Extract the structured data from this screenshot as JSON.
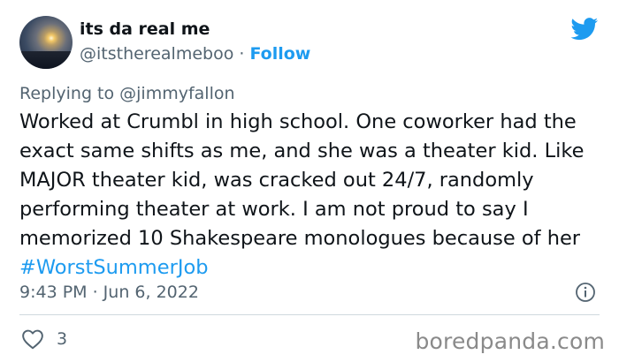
{
  "author": {
    "display_name": "its da real me",
    "handle": "@itstherealmeboo",
    "separator": " · ",
    "follow_label": "Follow"
  },
  "reply": {
    "prefix": "Replying to ",
    "mention": "@jimmyfallon"
  },
  "tweet": {
    "body": "Worked at Crumbl in high school. One coworker had the exact same shifts as me, and she was a theater kid. Like MAJOR theater kid, was cracked out 24/7, randomly performing theater at work. I am not proud to say I memorized 10 Shakespeare monologues because of her ",
    "hashtag": "#WorstSummerJob",
    "timestamp": "9:43 PM · Jun 6, 2022"
  },
  "engagement": {
    "likes": "3"
  },
  "watermark": "boredpanda.com",
  "icons": {
    "brand": "twitter-bird-icon",
    "info": "info-icon",
    "like": "heart-icon"
  },
  "colors": {
    "accent": "#1d9bf0",
    "muted": "#536471",
    "text": "#0f1419",
    "divider": "#cfd9de"
  }
}
